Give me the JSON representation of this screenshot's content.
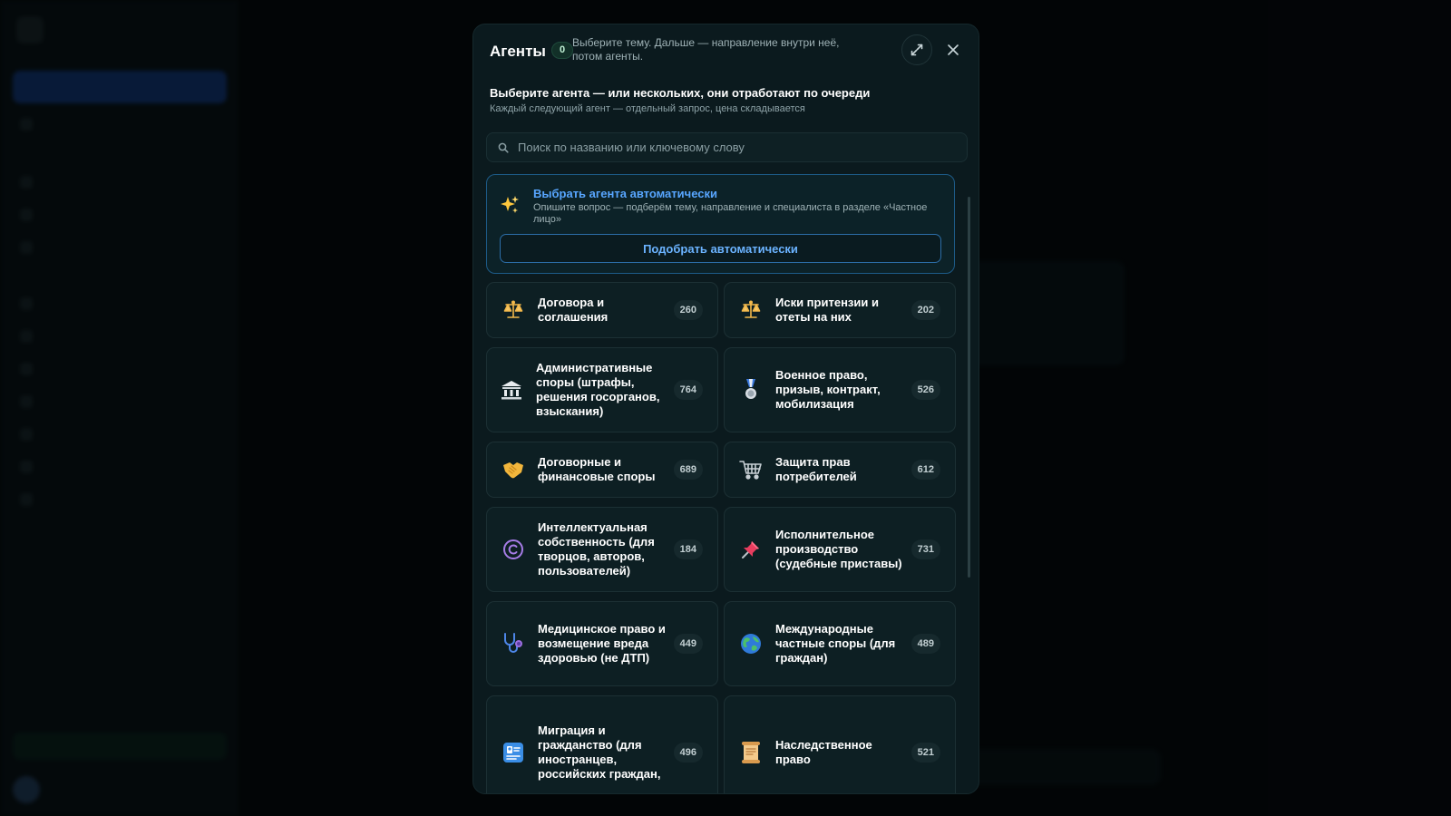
{
  "modal": {
    "title": "Агенты",
    "selected_count": "0",
    "header_hint": "Выберите тему. Дальше — направление внутри неё, потом агенты.",
    "section_title": "Выберите агента — или нескольких, они отработают по очереди",
    "section_subtitle": "Каждый следующий агент — отдельный запрос, цена складывается",
    "search_placeholder": "Поиск по названию или ключевому слову",
    "auto": {
      "title": "Выбрать агента автоматически",
      "description": "Опишите вопрос — подберём тему, направление и специалиста в разделе «Частное лицо»",
      "button_label": "Подобрать автоматически"
    },
    "categories": [
      {
        "label": "Договора и соглашения",
        "count": "260",
        "icon": "scales-icon"
      },
      {
        "label": "Иски притензии и отеты на них",
        "count": "202",
        "icon": "scales-icon"
      },
      {
        "label": "Административные споры (штрафы, решения госорганов, взыскания)",
        "count": "764",
        "icon": "classical-building-icon"
      },
      {
        "label": "Военное право, призыв, контракт, мобилизация",
        "count": "526",
        "icon": "military-medal-icon"
      },
      {
        "label": "Договорные и финансовые споры",
        "count": "689",
        "icon": "handshake-icon"
      },
      {
        "label": "Защита прав потребителей",
        "count": "612",
        "icon": "shopping-cart-icon"
      },
      {
        "label": "Интеллектуальная собственность (для творцов, авторов, пользователей)",
        "count": "184",
        "icon": "copyright-icon"
      },
      {
        "label": "Исполнительное производство (судебные приставы)",
        "count": "731",
        "icon": "pushpin-icon"
      },
      {
        "label": "Медицинское право и возмещение вреда здоровью (не ДТП)",
        "count": "449",
        "icon": "stethoscope-icon"
      },
      {
        "label": "Международные частные споры (для граждан)",
        "count": "489",
        "icon": "globe-icon"
      },
      {
        "label": "Миграция и гражданство (для иностранцев, российских граждан,",
        "count": "496",
        "icon": "passport-control-icon"
      },
      {
        "label": "Наследственное право",
        "count": "521",
        "icon": "scroll-icon"
      }
    ]
  }
}
